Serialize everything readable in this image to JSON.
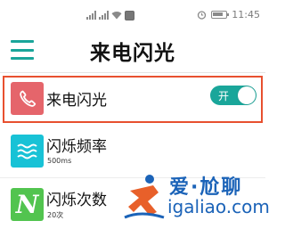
{
  "status_bar": {
    "left_text": "ᵘ",
    "time": "11:45",
    "icons": [
      "signal-icon",
      "signal-icon",
      "wifi-icon",
      "app-icon",
      "alarm-icon",
      "battery-icon"
    ]
  },
  "header": {
    "title": "来电闪光",
    "menu_icon": "menu-icon"
  },
  "list": {
    "items": [
      {
        "label": "来电闪光",
        "icon": "phone-icon",
        "toggle_label": "开",
        "toggle_on": true,
        "highlighted": true
      },
      {
        "label": "闪烁频率",
        "sub": "500ms",
        "icon": "wave-icon"
      },
      {
        "label": "闪烁次数",
        "sub": "20次",
        "icon": "n-letter-icon",
        "icon_text": "N"
      }
    ]
  },
  "watermark": {
    "line1": "爱·尬聊",
    "line2": "igaliao.com"
  },
  "colors": {
    "accent": "#1aa69a",
    "highlight_border": "#e8502f",
    "phone_icon_bg": "#e5656b",
    "wave_icon_bg": "#18c2d6",
    "n_icon_bg": "#52c44f",
    "watermark_blue": "#1b63b8",
    "watermark_orange": "#e8602a"
  }
}
